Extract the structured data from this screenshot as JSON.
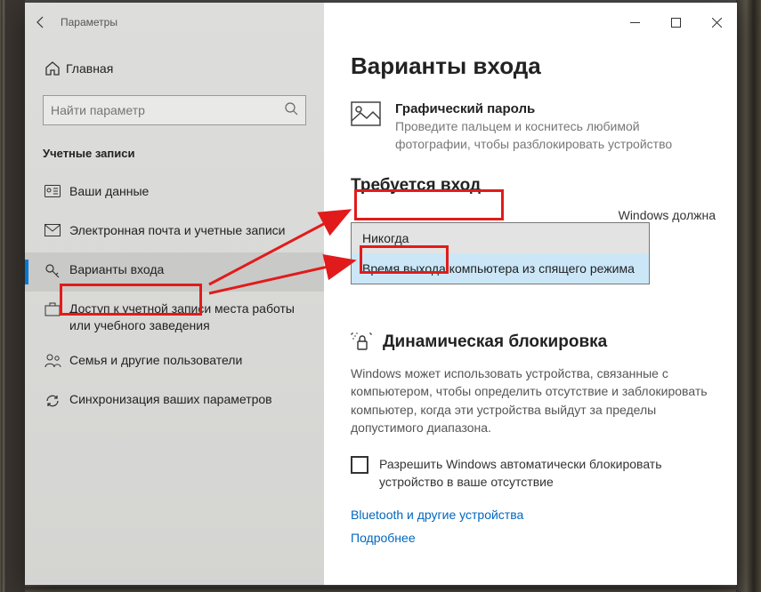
{
  "titlebar": {
    "title": "Параметры"
  },
  "sidebar": {
    "home": "Главная",
    "search_placeholder": "Найти параметр",
    "section": "Учетные записи",
    "items": [
      {
        "label": "Ваши данные"
      },
      {
        "label": "Электронная почта и учетные записи"
      },
      {
        "label": "Варианты входа"
      },
      {
        "label": "Доступ к учетной записи места работы или учебного заведения"
      },
      {
        "label": "Семья и другие пользователи"
      },
      {
        "label": "Синхронизация ваших параметров"
      }
    ]
  },
  "main": {
    "heading": "Варианты входа",
    "picpw": {
      "title": "Графический пароль",
      "desc": "Проведите пальцем и коснитесь любимой фотографии, чтобы разблокировать устройство"
    },
    "require": {
      "heading": "Требуется вход",
      "trail": "Windows должна",
      "options": {
        "never": "Никогда",
        "wake": "Время выхода компьютера из спящего режима"
      }
    },
    "dynlock": {
      "heading": "Динамическая блокировка",
      "desc": "Windows может использовать устройства, связанные с компьютером, чтобы определить отсутствие и заблокировать компьютер, когда эти устройства выйдут за пределы допустимого диапазона.",
      "checkbox": "Разрешить Windows автоматически блокировать устройство в ваше отсутствие"
    },
    "links": {
      "bt": "Bluetooth и другие устройства",
      "more": "Подробнее"
    }
  }
}
